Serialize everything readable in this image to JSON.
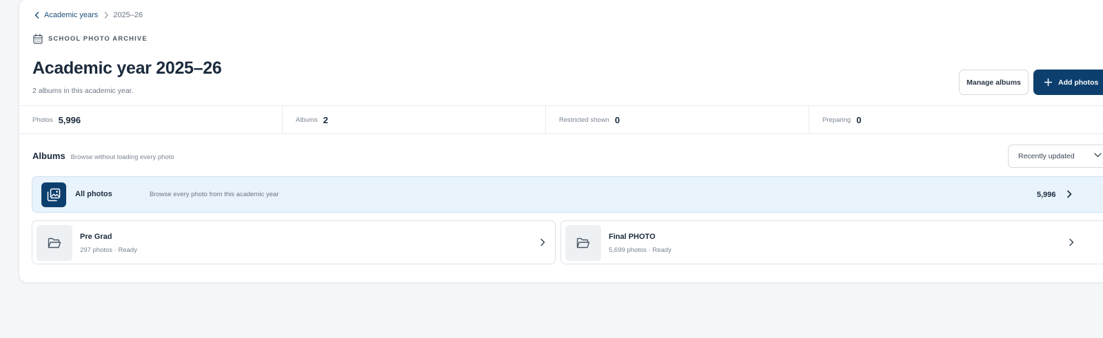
{
  "breadcrumb": {
    "parent": "Academic years",
    "current": "2025–26"
  },
  "header": {
    "eyebrow": "SCHOOL PHOTO ARCHIVE",
    "title": "Academic year 2025–26",
    "subtitle": "2 albums in this academic year.",
    "manage_label": "Manage albums",
    "add_label": "Add photos"
  },
  "stats": [
    {
      "label": "Photos",
      "value": "5,996"
    },
    {
      "label": "Albums",
      "value": "2"
    },
    {
      "label": "Restricted shown",
      "value": "0"
    },
    {
      "label": "Preparing",
      "value": "0"
    }
  ],
  "albums_section": {
    "title": "Albums",
    "subtitle": "Browse without loading every photo",
    "sort_value": "Recently updated"
  },
  "all_photos": {
    "title": "All photos",
    "description": "Browse every photo from this academic year",
    "count": "5,996"
  },
  "albums": [
    {
      "name": "Pre Grad",
      "meta": "297 photos · Ready"
    },
    {
      "name": "Final PHOTO",
      "meta": "5,699 photos · Ready"
    }
  ],
  "colors": {
    "primary": "#0d3f6e",
    "highlight_bg": "#e9f3fc",
    "page_bg": "#f5f6f8"
  }
}
